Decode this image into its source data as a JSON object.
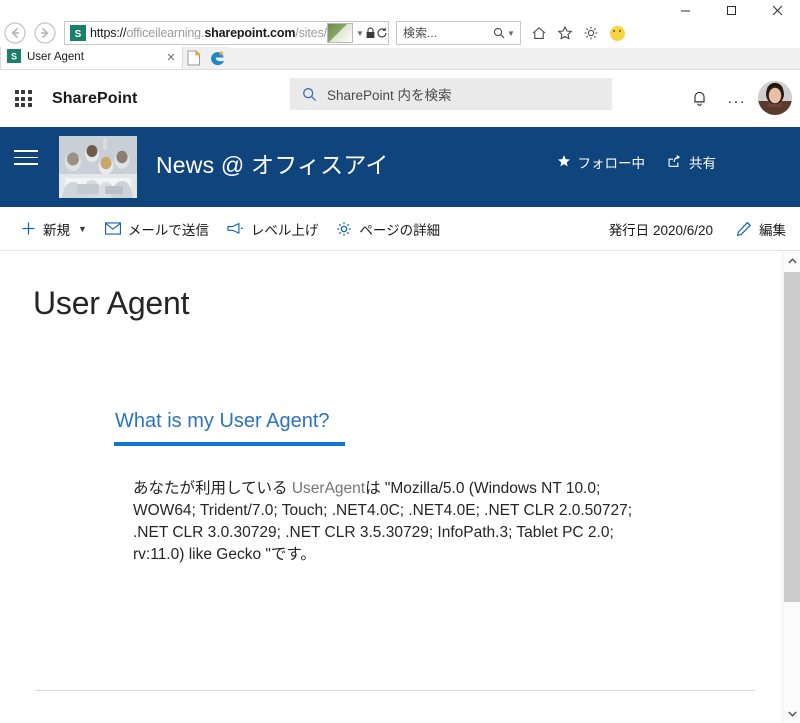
{
  "window": {
    "minimize_label": "minimize",
    "maximize_label": "maximize",
    "close_label": "close"
  },
  "browser": {
    "back_label": "戻る",
    "forward_label": "進む",
    "url": {
      "scheme": "https://",
      "host_prefix": "officeilearning.",
      "host_bold": "sharepoint.com",
      "path": "/sites/Landing/SitePages"
    },
    "url_full": "https://officeilearning.sharepoint.com/sites/Landing/SitePages",
    "search_placeholder": "検索...",
    "tab": {
      "title": "User Agent",
      "close_label": "✕"
    },
    "new_tab_label": "新しいタブ",
    "icons": {
      "back": "back-arrow-icon",
      "forward": "forward-arrow-icon",
      "lock": "lock-icon",
      "refresh": "refresh-icon",
      "search": "search-icon",
      "home": "home-icon",
      "favorites": "star-icon",
      "settings": "gear-icon",
      "feedback": "smiley-icon"
    }
  },
  "suitebar": {
    "waffle_label": "アプリ起動ツール",
    "brand": "SharePoint",
    "search_placeholder": "SharePoint 内を検索",
    "notifications_label": "通知",
    "more_label": "...",
    "account_label": "アカウント マネージャー"
  },
  "siteheader": {
    "menu_label": "サイト ナビゲーション",
    "logo_label": "サイト ロゴ",
    "title": "News @ オフィスアイ",
    "follow_label": "フォロー中",
    "share_label": "共有",
    "background": "#10447c"
  },
  "commandbar": {
    "new_label": "新規",
    "email_label": "メールで送信",
    "promote_label": "レベル上げ",
    "page_details_label": "ページの詳細",
    "published_label": "発行日 2020/6/20",
    "edit_label": "編集",
    "accent": "#0f63b0"
  },
  "page": {
    "title": "User Agent",
    "section_heading": "What is my User Agent?",
    "section_heading_color": "#2b74c0",
    "underline_color": "#1277cc",
    "body_prefix": "あなたが利用している ",
    "body_ua_label": "UserAgent",
    "body_middle": "は \"",
    "user_agent": "Mozilla/5.0 (Windows NT 10.0; WOW64; Trident/7.0; Touch; .NET4.0C; .NET4.0E; .NET CLR 2.0.50727; .NET CLR 3.0.30729; .NET CLR 3.5.30729; InfoPath.3; Tablet PC 2.0; rv:11.0) like Gecko ",
    "body_suffix": "\"です。",
    "body_full": "あなたが利用している UserAgentは \"Mozilla/5.0 (Windows NT 10.0; WOW64; Trident/7.0; Touch; .NET4.0C; .NET4.0E; .NET CLR 2.0.50727; .NET CLR 3.0.30729; .NET CLR 3.5.30729; InfoPath.3; Tablet PC 2.0; rv:11.0) like Gecko \"です。"
  },
  "scrollbar": {
    "up_label": "上にスクロール",
    "down_label": "下にスクロール"
  }
}
